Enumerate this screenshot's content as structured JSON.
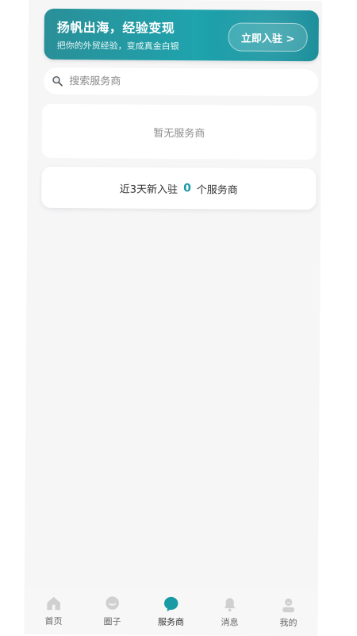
{
  "banner": {
    "title": "扬帆出海，经验变现",
    "subtitle": "把你的外贸经验，变成真金白银",
    "button_label": "立即入驻 >"
  },
  "search": {
    "placeholder": "搜索服务商"
  },
  "empty_state": {
    "text": "暂无服务商"
  },
  "stats": {
    "prefix": "近3天新入驻",
    "count": "0",
    "suffix": "个服务商"
  },
  "tabbar": {
    "items": [
      {
        "label": "首页",
        "icon": "home-icon",
        "active": false
      },
      {
        "label": "圈子",
        "icon": "chat-icon",
        "active": false
      },
      {
        "label": "服务商",
        "icon": "service-icon",
        "active": true
      },
      {
        "label": "消息",
        "icon": "bell-icon",
        "active": false
      },
      {
        "label": "我的",
        "icon": "user-icon",
        "active": false
      }
    ]
  },
  "colors": {
    "accent": "#1a9aa5",
    "banner_start": "#2a8f98",
    "banner_end": "#1a8e9a",
    "inactive_icon": "#d0d0d0"
  }
}
